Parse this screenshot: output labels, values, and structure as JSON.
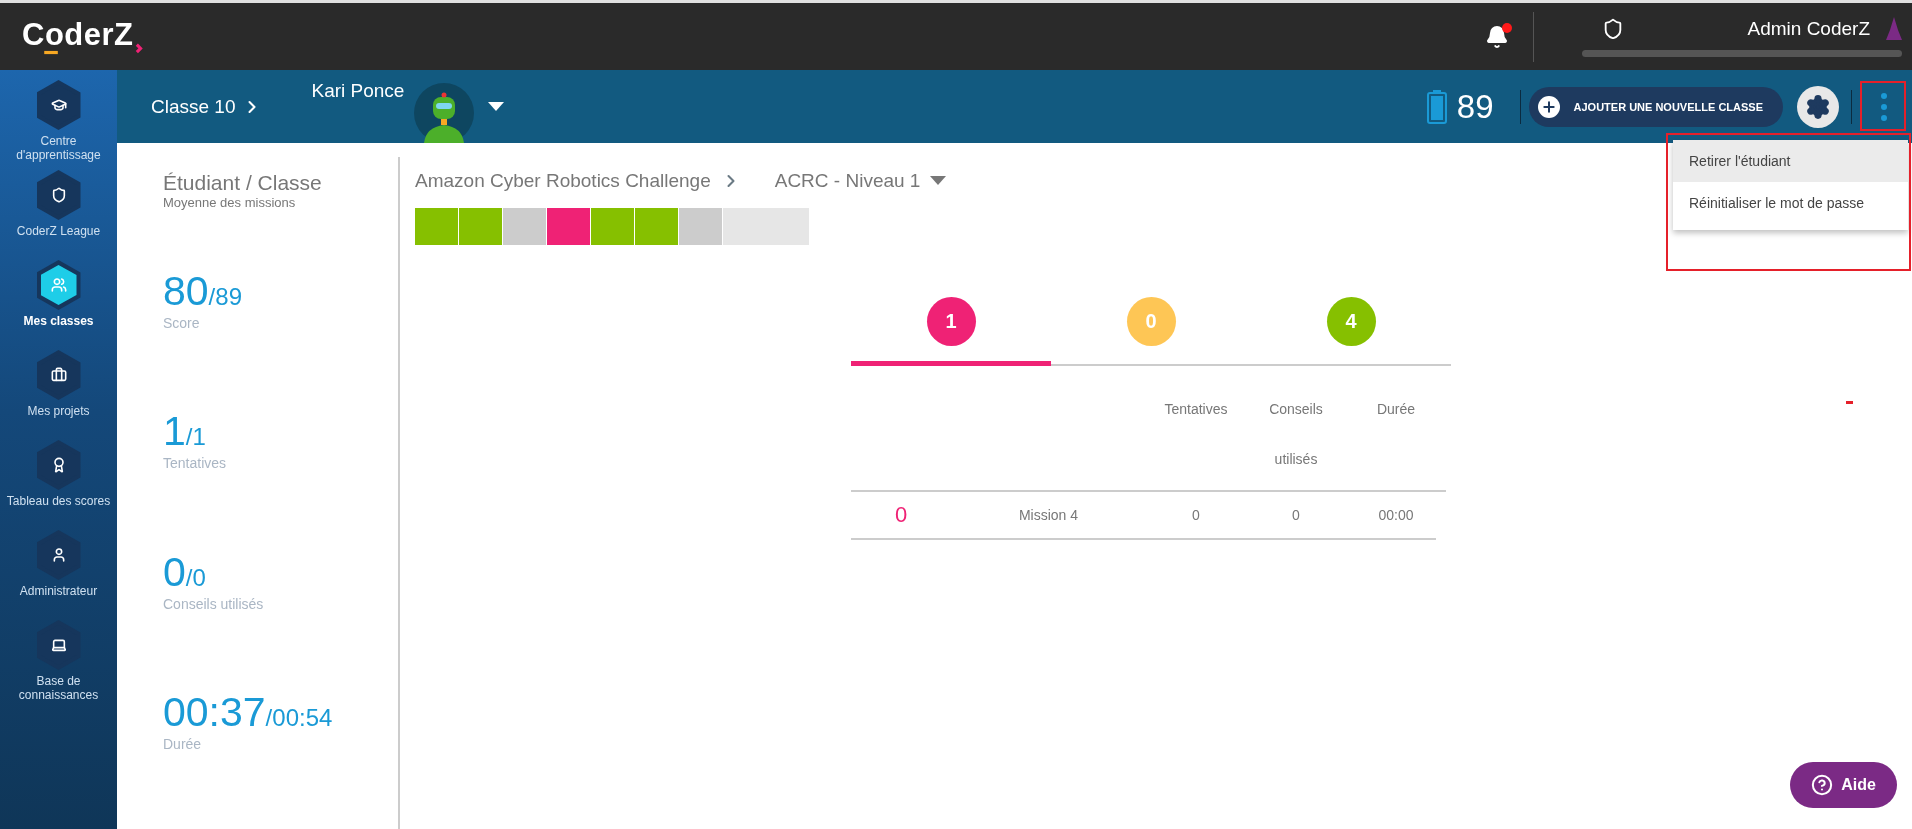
{
  "app_bar": {
    "logo": "CoderZ",
    "notification_unread": true,
    "user_name": "Admin CoderZ",
    "progress": {
      "level": 0
    }
  },
  "sidebar": {
    "items": [
      {
        "kind": "learning",
        "label": "Centre d'apprentissage",
        "selected": false
      },
      {
        "kind": "league",
        "label": "CoderZ League",
        "selected": false
      },
      {
        "kind": "classes",
        "label": "Mes classes",
        "selected": true
      },
      {
        "kind": "projects",
        "label": "Mes projets",
        "selected": false
      },
      {
        "kind": "leaderboard",
        "label": "Tableau des scores",
        "selected": false
      },
      {
        "kind": "admin",
        "label": "Administrateur",
        "selected": false
      },
      {
        "kind": "knowledge",
        "label": "Base de connaissances",
        "selected": false
      }
    ]
  },
  "header": {
    "class_name": "Classe 10",
    "student_name": "Kari Ponce",
    "score": "89",
    "add_button": "AJOUTER UNE NOUVELLE CLASSE",
    "menu_open": true
  },
  "menu": {
    "items": [
      {
        "label": "Retirer l'étudiant",
        "selected": true
      },
      {
        "label": "Réinitialiser le mot de passe",
        "selected": false
      }
    ]
  },
  "stats": {
    "title": "Étudiant / Classe",
    "subtitle": "Moyenne des missions",
    "items": [
      {
        "value": "80",
        "total": "/89",
        "label": "Score"
      },
      {
        "value": "1",
        "total": "/1",
        "label": "Tentatives"
      },
      {
        "value": "0",
        "total": "/0",
        "label": "Conseils utilisés"
      },
      {
        "value": "00:37",
        "total": "/00:54",
        "label": "Durée"
      }
    ]
  },
  "course": {
    "name": "Amazon Cyber Robotics Challenge",
    "level": "ACRC - Niveau 1",
    "segments": [
      {
        "color": "#86c000",
        "wide": false
      },
      {
        "color": "#86c000",
        "wide": false
      },
      {
        "color": "#cccccc",
        "wide": false
      },
      {
        "color": "#ef2275",
        "wide": false
      },
      {
        "color": "#86c000",
        "wide": false
      },
      {
        "color": "#86c000",
        "wide": false
      },
      {
        "color": "#cccccc",
        "wide": false
      },
      {
        "color": "#e6e6e6",
        "wide": true
      }
    ]
  },
  "tabs": [
    {
      "count": "1",
      "color": "#ef2275",
      "selected": true
    },
    {
      "count": "0",
      "color": "#fec655",
      "selected": false
    },
    {
      "count": "4",
      "color": "#86c000",
      "selected": false
    }
  ],
  "table": {
    "columns": [
      "Tentatives",
      "Conseils utilisés",
      "Durée"
    ],
    "rows": [
      {
        "score": "0",
        "mission": "Mission 4",
        "attempts": "0",
        "hints": "0",
        "duration": "00:00"
      }
    ]
  },
  "help_button": "Aide",
  "annotations": {
    "menu_button_framed": true,
    "menu_framed": true,
    "stray_mark": true
  }
}
